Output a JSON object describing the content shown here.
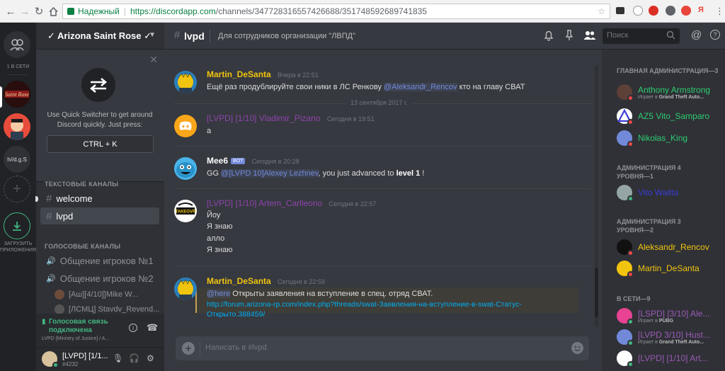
{
  "browser": {
    "secure_label": "Надежный",
    "url_host": "https://discordapp.com",
    "url_path": "/channels/347728316557426688/351748592689741835"
  },
  "guilds": {
    "online_label": "1 В СЕТИ",
    "server2_label": "h//d.g.S",
    "download_label": "ЗАГРУЗИТЬ ПРИЛОЖЕНИЯ"
  },
  "server": {
    "name": "✓ Arizona Saint Rose ✓"
  },
  "switcher": {
    "text": "Use Quick Switcher to get around Discord quickly. Just press:",
    "shortcut": "CTRL + K"
  },
  "channels": {
    "text_category": "ТЕКСТОВЫЕ КАНАЛЫ",
    "text_channels": [
      "welcome",
      "lvpd"
    ],
    "voice_category": "ГОЛОСОВЫЕ КАНАЛЫ",
    "voice_channels": [
      "Общение игроков №1",
      "Общение игроков №2"
    ],
    "voice_users": [
      "[Аш][4/10]]Mike W...",
      "[ЛСМЦ] Stavdv_Revend..."
    ]
  },
  "voice_panel": {
    "status": "Голосовая связь подключена",
    "detail": "LVPD [Ministry of Justice] / A..."
  },
  "user_panel": {
    "name": "[LVPD] [1/1...",
    "tag": "#4232"
  },
  "header": {
    "channel": "lvpd",
    "topic": "Для сотрудников организации \"ЛВПД\"",
    "search_placeholder": "Поиск"
  },
  "messages": [
    {
      "author": "Martin_DeSanta",
      "time": "Вчера в 22:51",
      "color": "#f1c40f",
      "pre": "Ещё раз продублируйте свои ники в ЛС Ренкову ",
      "mention": "@Aleksandr_Rencov",
      "post": " кто на главу СВАТ"
    },
    {
      "date_divider": "13 сентября 2017 г."
    },
    {
      "author": "[LVPD] [1/10] Vladimir_Pizano",
      "time": "Сегодня в 19:51",
      "color": "#8e44ad",
      "line": "а"
    },
    {
      "author": "Mee6",
      "bot_tag": "BOT",
      "time": "Сегодня в 20:28",
      "color": "#ffffff",
      "pre": "GG ",
      "mention": "@[LVPD 10]Alexey Lezhnev",
      "mid": ", you just advanced to ",
      "bold": "level 1",
      "post": " !"
    },
    {
      "author": "[LVPD] [1/10] Artem_Carlleono",
      "time": "Сегодня в 22:57",
      "color": "#8e44ad",
      "lines": [
        "Йоу",
        "Я знаю",
        "алло",
        "Я знаю"
      ]
    },
    {
      "author": "Martin_DeSanta",
      "time": "Сегодня в 22:59",
      "color": "#f1c40f",
      "mention": "@here",
      "post": " Открыты заявления на вступление в спец. отряд СВАТ.",
      "link1": "http://forum.arizona-rp.com/index.php?threads/swat-Заявления-на-вступление-в-swat-Статус-",
      "link2": "Открыто.388459/"
    }
  ],
  "input": {
    "placeholder": "Написать в #lvpd"
  },
  "members": {
    "cat1": "ГЛАВНАЯ АДМИНИСТРАЦИЯ—3",
    "cat2a": "АДМИНИСТРАЦИЯ 4",
    "cat2b": "УРОВНЯ—1",
    "cat3a": "АДМИНИСТРАЦИЯ 3",
    "cat3b": "УРОВНЯ—2",
    "cat4": "В СЕТИ—9",
    "list": [
      {
        "name": "Anthony Armstrong",
        "color": "#2ecc71",
        "game_prefix": "Играет в ",
        "game": "Grand Theft Auto..."
      },
      {
        "name": "AZ5 Vito_Samparo",
        "color": "#2ecc71"
      },
      {
        "name": "Nikolas_King",
        "color": "#2ecc71"
      },
      {
        "name": "Vito Waitta",
        "color": "#3b3bd6"
      },
      {
        "name": "Aleksandr_Rencov",
        "color": "#f1c40f"
      },
      {
        "name": "Martin_DeSanta",
        "color": "#f1c40f"
      },
      {
        "name": "[LSPD] [3/10] Ale...",
        "color": "#9b59b6",
        "game_prefix": "Играет в ",
        "game": "PUBG"
      },
      {
        "name": "[LVPD 3/10] Hust...",
        "color": "#9b59b6",
        "game_prefix": "Играет в ",
        "game": "Grand Theft Auto..."
      },
      {
        "name": "[LVPD] [1/10] Art...",
        "color": "#9b59b6"
      }
    ]
  },
  "colors": {
    "accent": "#7289da",
    "online": "#43b581",
    "dnd": "#f04747",
    "idle": "#faa61a"
  }
}
